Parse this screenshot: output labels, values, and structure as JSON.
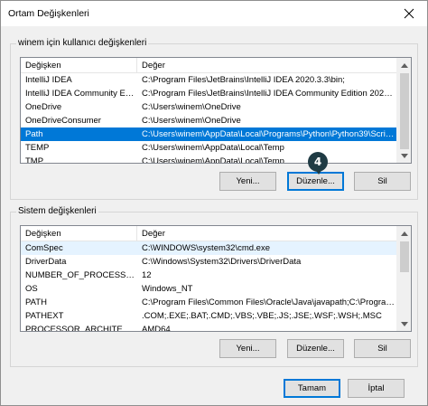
{
  "window": {
    "title": "Ortam Değişkenleri"
  },
  "user_vars": {
    "group_label": "winem için kullanıcı değişkenleri",
    "headers": [
      "Değişken",
      "Değer"
    ],
    "rows": [
      {
        "name": "IntelliJ IDEA",
        "value": "C:\\Program Files\\JetBrains\\IntelliJ IDEA 2020.3.3\\bin;"
      },
      {
        "name": "IntelliJ IDEA Community Editi...",
        "value": "C:\\Program Files\\JetBrains\\IntelliJ IDEA Community Edition 2020.2.3..."
      },
      {
        "name": "OneDrive",
        "value": "C:\\Users\\winem\\OneDrive"
      },
      {
        "name": "OneDriveConsumer",
        "value": "C:\\Users\\winem\\OneDrive"
      },
      {
        "name": "Path",
        "value": "C:\\Users\\winem\\AppData\\Local\\Programs\\Python\\Python39\\Scrip..."
      },
      {
        "name": "TEMP",
        "value": "C:\\Users\\winem\\AppData\\Local\\Temp"
      },
      {
        "name": "TMP",
        "value": "C:\\Users\\winem\\AppData\\Local\\Temp"
      }
    ],
    "selected_index": 4,
    "buttons": {
      "new": "Yeni...",
      "edit": "Düzenle...",
      "delete": "Sil"
    }
  },
  "system_vars": {
    "group_label": "Sistem değişkenleri",
    "headers": [
      "Değişken",
      "Değer"
    ],
    "rows": [
      {
        "name": "ComSpec",
        "value": "C:\\WINDOWS\\system32\\cmd.exe"
      },
      {
        "name": "DriverData",
        "value": "C:\\Windows\\System32\\Drivers\\DriverData"
      },
      {
        "name": "NUMBER_OF_PROCESSORS",
        "value": "12"
      },
      {
        "name": "OS",
        "value": "Windows_NT"
      },
      {
        "name": "PATH",
        "value": "C:\\Program Files\\Common Files\\Oracle\\Java\\javapath;C:\\Program ..."
      },
      {
        "name": "PATHEXT",
        "value": ".COM;.EXE;.BAT;.CMD;.VBS;.VBE;.JS;.JSE;.WSF;.WSH;.MSC"
      },
      {
        "name": "PROCESSOR_ARCHITECTURE",
        "value": "AMD64"
      }
    ],
    "hover_index": 0,
    "buttons": {
      "new": "Yeni...",
      "edit": "Düzenle...",
      "delete": "Sil"
    }
  },
  "footer": {
    "ok": "Tamam",
    "cancel": "İptal"
  },
  "annotation": {
    "step": "4",
    "color": "#1f3b44"
  },
  "colors": {
    "selection": "#0078d7",
    "button_face": "#e1e1e1",
    "dialog_bg": "#f0f0f0"
  }
}
